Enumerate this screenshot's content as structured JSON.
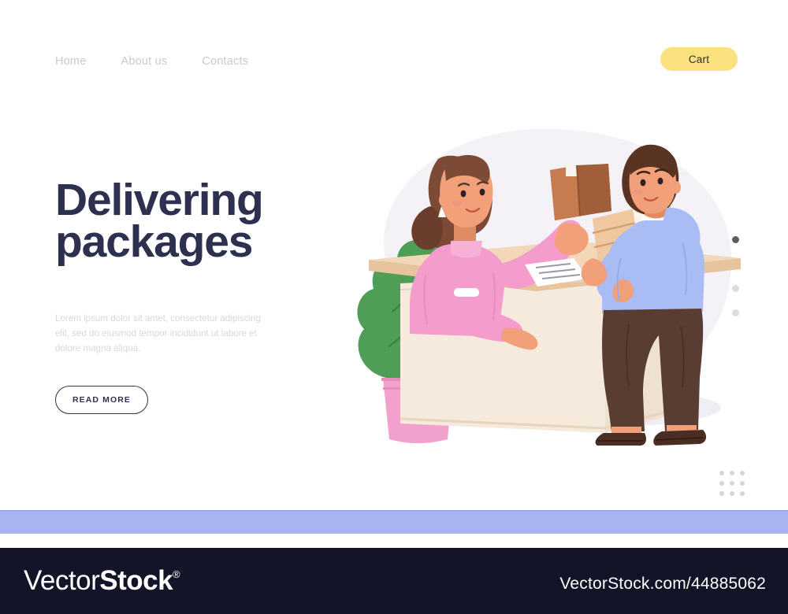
{
  "nav": {
    "links": [
      {
        "label": "Home",
        "name": "nav-link-home"
      },
      {
        "label": "About us",
        "name": "nav-link-about-us"
      },
      {
        "label": "Contacts",
        "name": "nav-link-contacts"
      }
    ],
    "cart_label": "Cart",
    "cart_color": "#fbe27e"
  },
  "hero": {
    "headline_line1": "Delivering",
    "headline_line2": "packages",
    "headline_color": "#2e3050",
    "paragraph": "Lorem ipsum dolor sit amet, consectetur adipiscing elit, sed do eiusmod tempor incididunt ut labore et dolore magna aliqua.",
    "cta_label": "READ MORE"
  },
  "carousel": {
    "dots": [
      {
        "active": true
      },
      {
        "active": false
      },
      {
        "active": false
      },
      {
        "active": false
      }
    ],
    "active_color": "#5c5c66",
    "inactive_color": "#dcdce0"
  },
  "decor": {
    "dot_grid_rows": 3,
    "dot_grid_cols": 3,
    "dot_grid_color": "#d5d5da"
  },
  "illustration": {
    "scene": "delivery-courier-handing-package-at-reception-counter",
    "elements": [
      "background-blob",
      "potted-plant",
      "reception-counter",
      "receptionist-woman",
      "courier-man",
      "cardboard-box-small",
      "cardboard-box-large",
      "paper-document",
      "floor-shadow"
    ],
    "colors": {
      "blob": "#f4f2f7",
      "counter_top": "#f0d6b8",
      "counter_body": "#f5eadc",
      "woman_sweater": "#f49ccb",
      "man_hoodie": "#a9bdf4",
      "man_pants": "#5a3d32",
      "skin": "#f2a07a",
      "hair_brown": "#7d4a35",
      "box_brown": "#b06c43",
      "box_tan": "#e8b98c",
      "plant_green": "#4f9e56",
      "pot_pink": "#f2a0cc"
    }
  },
  "footer": {
    "band_color": "#a8b4f0",
    "bar_color": "#141429",
    "logo_light": "Vector",
    "logo_bold": "Stock",
    "logo_mark": "®",
    "credit": "VectorStock.com/44885062"
  }
}
